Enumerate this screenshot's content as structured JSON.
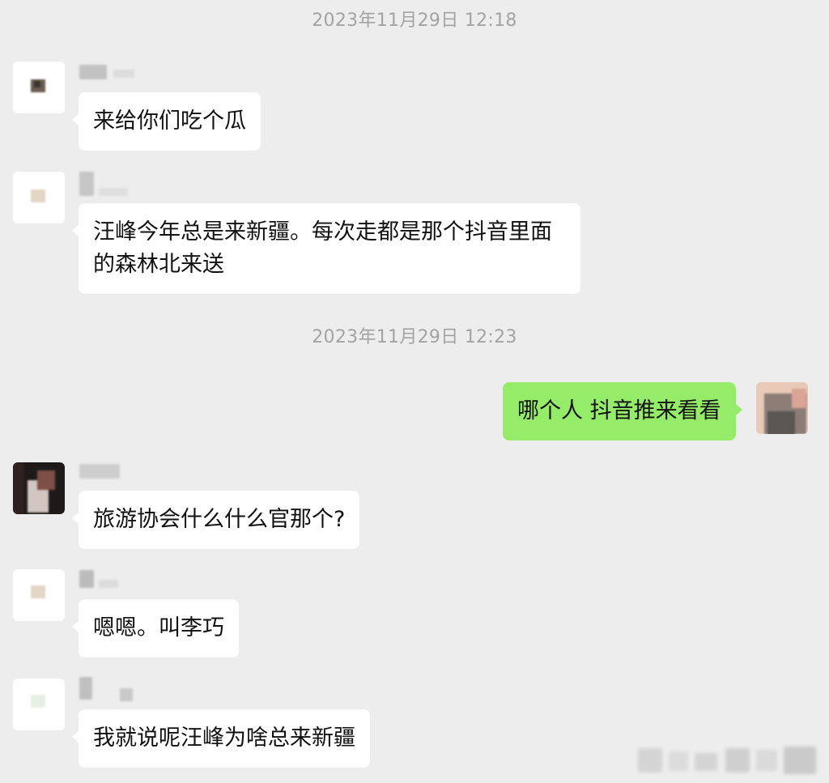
{
  "timestamps": {
    "first": "2023年11月29日 12:18",
    "second": "2023年11月29日 12:23"
  },
  "messages": [
    {
      "sender": "other",
      "text": "来给你们吃个瓜"
    },
    {
      "sender": "other",
      "text": "汪峰今年总是来新疆。每次走都是那个抖音里面\n的森林北来送"
    },
    {
      "sender": "me",
      "text": "哪个人 抖音推来看看"
    },
    {
      "sender": "other",
      "text": "旅游协会什么什么官那个?"
    },
    {
      "sender": "other",
      "text": "嗯嗯。叫李巧"
    },
    {
      "sender": "other",
      "text": "我就说呢汪峰为啥总来新疆"
    }
  ],
  "colors": {
    "background": "#ededed",
    "incoming_bubble": "#ffffff",
    "outgoing_bubble": "#95ec69",
    "timestamp_text": "#a3a3a3"
  },
  "icons": {
    "avatar": "blurred-avatar",
    "nickname": "blurred-nickname"
  }
}
